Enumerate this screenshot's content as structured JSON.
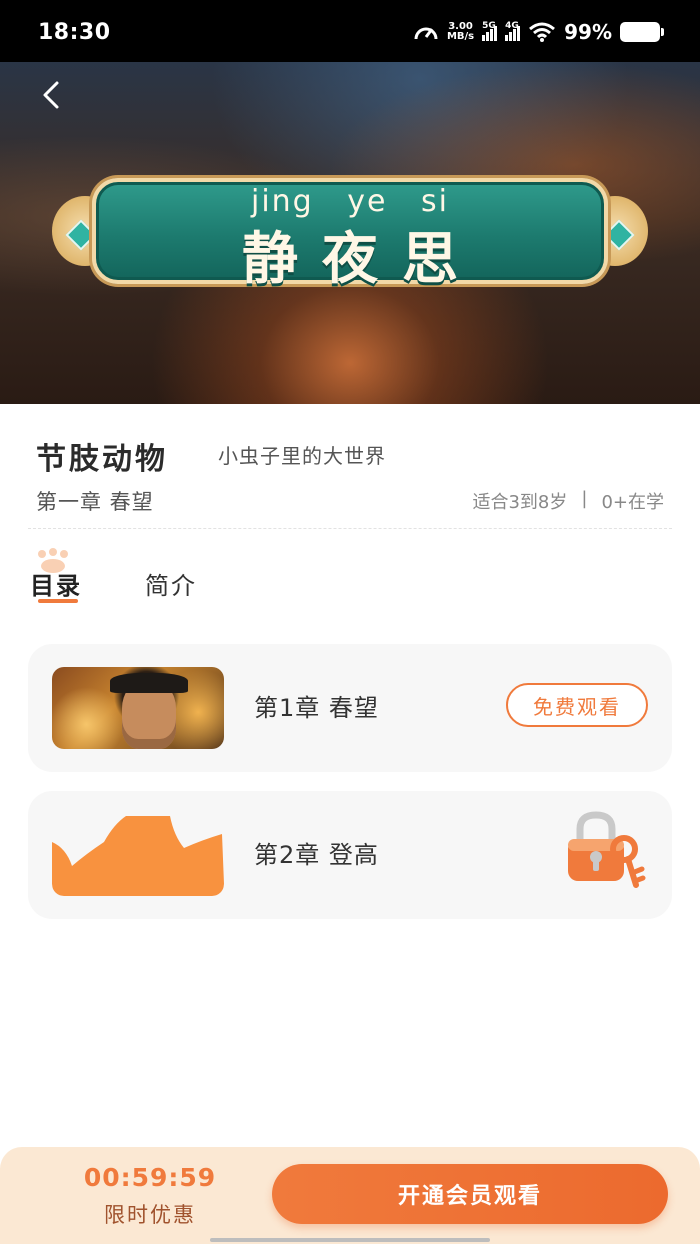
{
  "status_bar": {
    "time": "18:30",
    "network_speed_value": "3.00",
    "network_speed_unit": "MB/s",
    "sim1_label": "5G",
    "sim2_label": "4G",
    "battery_percent": "99%"
  },
  "hero": {
    "back_icon": "chevron-left-icon",
    "pinyin": "jing ye si",
    "title": "静夜思"
  },
  "course": {
    "name": "节肢动物",
    "subtitle": "小虫子里的大世界",
    "current_chapter": "第一章 春望",
    "age_range": "适合3到8岁",
    "separator": "|",
    "learners": "0+在学"
  },
  "tabs": [
    {
      "label": "目录",
      "active": true
    },
    {
      "label": "简介",
      "active": false
    }
  ],
  "chapters": [
    {
      "title": "第1章 春望",
      "action_label": "免费观看",
      "locked": false
    },
    {
      "title": "第2章 登高",
      "action_label": "",
      "locked": true,
      "lock_icon": "lock-and-key-icon"
    }
  ],
  "bottom_bar": {
    "countdown": "00:59:59",
    "promo_label": "限时优惠",
    "cta_label": "开通会员观看"
  },
  "colors": {
    "accent": "#f07a3c",
    "bottom_bar_bg": "#fbe8d3",
    "plaque_teal": "#1d7b6f"
  }
}
